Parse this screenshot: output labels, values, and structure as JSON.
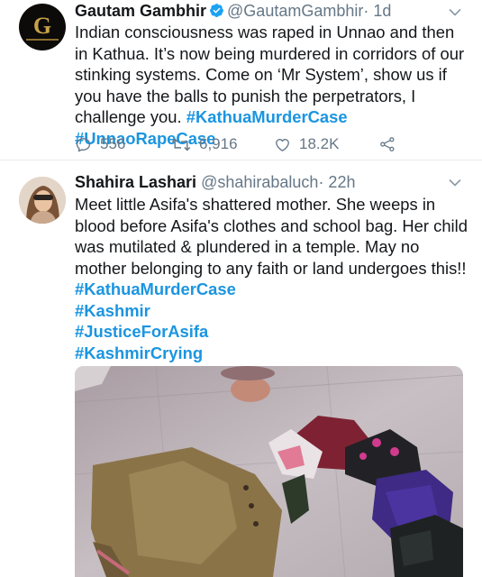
{
  "tweet1": {
    "name": "Gautam Gambhir",
    "handle": "@GautamGambhir",
    "time": "· 1d",
    "text": "Indian consciousness was raped in Unnao and then in Kathua. It’s now being murdered in corridors of our stinking systems. Come on ‘Mr System’, show us if you have the balls to punish the perpetrators, I challenge you.",
    "hashtags": [
      "#KathuaMurderCase",
      "#UnnaoRapeCase"
    ],
    "replies": "556",
    "retweets": "6,916",
    "likes": "18.2K",
    "avatar_letter": "G"
  },
  "tweet2": {
    "name": "Shahira Lashari",
    "handle": "@shahirabaluch",
    "time": "· 22h",
    "text": "Meet little Asifa's shattered mother. She weeps in blood before Asifa's clothes and school bag. Her child was mutilated & plundered in a temple. May no mother belonging to any faith or land undergoes this!!",
    "hashtags": [
      "#KathuaMurderCase",
      "#Kashmir",
      "#JusticeForAsifa",
      "#KashmirCrying"
    ]
  },
  "colors": {
    "link": "#1b95e0",
    "muted": "#657786",
    "text": "#14171a",
    "verified": "#1da1f2"
  },
  "icons": [
    "chevron-down-icon",
    "verified-badge-icon",
    "reply-icon",
    "retweet-icon",
    "like-icon",
    "share-icon"
  ]
}
